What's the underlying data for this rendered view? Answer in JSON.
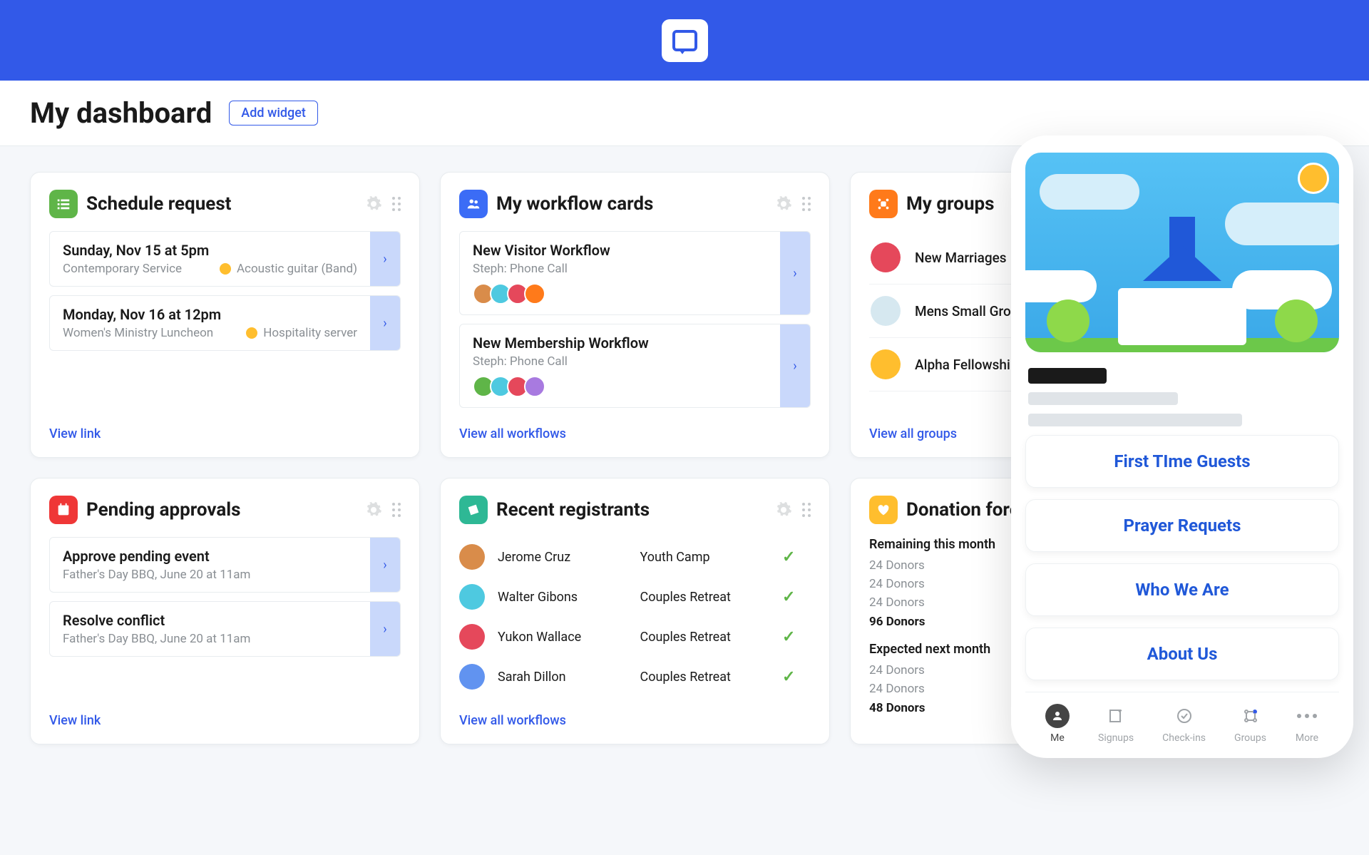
{
  "page": {
    "title": "My dashboard",
    "add_widget": "Add widget"
  },
  "cards": {
    "schedule": {
      "title": "Schedule request",
      "items": [
        {
          "title": "Sunday, Nov 15 at 5pm",
          "sub": "Contemporary Service",
          "badge": "Acoustic guitar (Band)"
        },
        {
          "title": "Monday, Nov 16 at 12pm",
          "sub": "Women's Ministry Luncheon",
          "badge": "Hospitality server"
        }
      ],
      "link": "View link"
    },
    "workflow": {
      "title": "My workflow cards",
      "items": [
        {
          "title": "New Visitor Workflow",
          "sub": "Steph: Phone Call"
        },
        {
          "title": "New Membership Workflow",
          "sub": "Steph: Phone Call"
        }
      ],
      "link": "View all workflows"
    },
    "groups": {
      "title": "My groups",
      "items": [
        {
          "name": "New Marriages"
        },
        {
          "name": "Mens Small Group"
        },
        {
          "name": "Alpha Fellowship"
        }
      ],
      "link": "View all groups"
    },
    "approvals": {
      "title": "Pending approvals",
      "items": [
        {
          "title": "Approve pending event",
          "sub": "Father's Day BBQ, June 20 at 11am"
        },
        {
          "title": "Resolve conflict",
          "sub": "Father's Day BBQ, June 20 at 11am"
        }
      ],
      "link": "View link"
    },
    "registrants": {
      "title": "Recent registrants",
      "rows": [
        {
          "name": "Jerome Cruz",
          "event": "Youth Camp"
        },
        {
          "name": "Walter Gibons",
          "event": "Couples Retreat"
        },
        {
          "name": "Yukon Wallace",
          "event": "Couples Retreat"
        },
        {
          "name": "Sarah Dillon",
          "event": "Couples Retreat"
        }
      ],
      "link": "View all workflows"
    },
    "donations": {
      "title": "Donation forecast",
      "remaining_head": "Remaining this month",
      "remaining": [
        "24 Donors",
        "24 Donors",
        "24 Donors"
      ],
      "remaining_total": "96 Donors",
      "expected_head": "Expected next month",
      "expected": [
        "24 Donors",
        "24 Donors"
      ],
      "expected_total": "48 Donors"
    }
  },
  "mobile": {
    "cards": [
      "First TIme Guests",
      "Prayer Requets",
      "Who We Are",
      "About Us"
    ],
    "nav": [
      "Me",
      "Signups",
      "Check-ins",
      "Groups",
      "More"
    ]
  }
}
